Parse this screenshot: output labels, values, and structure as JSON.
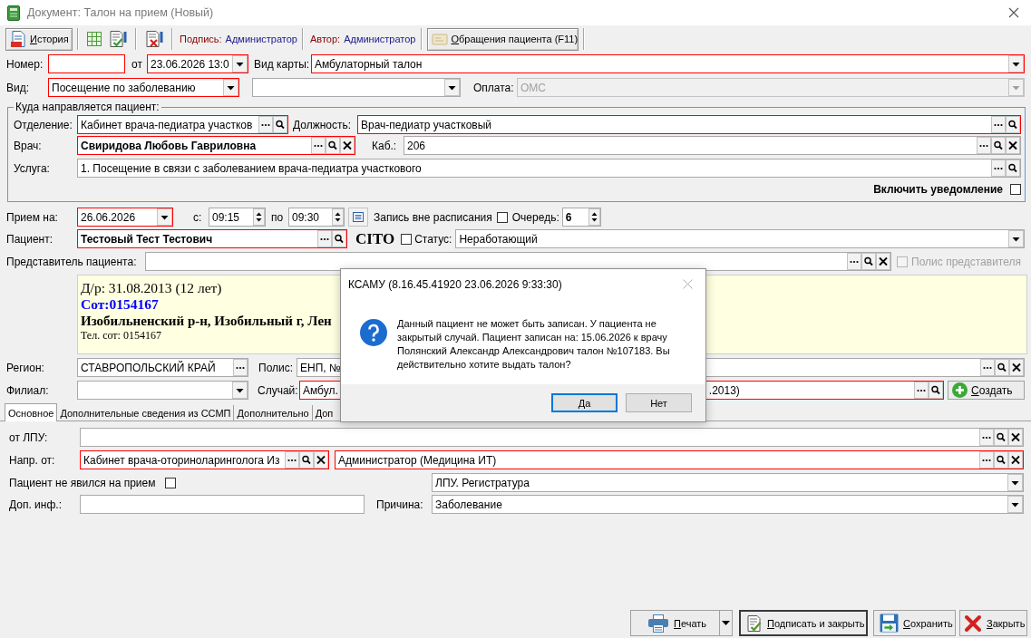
{
  "window": {
    "title": "Документ: Талон на прием (Новый)"
  },
  "toolbar": {
    "history_button": "История",
    "signature": {
      "label": "Подпись:",
      "value": "Администратор"
    },
    "author": {
      "label": "Автор:",
      "value": "Администратор"
    },
    "appeals_button": "Обращения пациента (F11)"
  },
  "header": {
    "number": {
      "label": "Номер:",
      "kind": "text",
      "required": true
    },
    "date": {
      "label": "от",
      "kind": "combo",
      "value": "23.06.2026 13:0",
      "required": true
    },
    "card_type": {
      "label": "Вид карты:",
      "kind": "combo",
      "value": "Амбулаторный талон",
      "required": true
    },
    "visit_type": {
      "label": "Вид:",
      "kind": "combo",
      "value": "Посещение по заболеванию",
      "required": true
    },
    "combo_2": {
      "kind": "combo",
      "required": false
    },
    "payment": {
      "label": "Оплата:",
      "kind": "combo",
      "value": "ОМС",
      "required": false,
      "disabled": true
    }
  },
  "destination": {
    "title": "Куда направляется пациент:",
    "department": {
      "label": "Отделение:",
      "kind": "lookup",
      "value": "Кабинет врача-педиатра участков",
      "required": true,
      "searchable": true,
      "clearable": false
    },
    "position": {
      "label": "Должность:",
      "kind": "lookup",
      "value": "Врач-педиатр участковый",
      "required": true,
      "searchable": true,
      "clearable": false
    },
    "doctor": {
      "label": "Врач:",
      "kind": "lookup",
      "value": "Свиридова Любовь Гавриловна",
      "required": true,
      "searchable": true,
      "clearable": true
    },
    "room": {
      "label": "Каб.:",
      "kind": "lookup",
      "value": "206",
      "required": false,
      "searchable": true,
      "clearable": true
    },
    "service": {
      "label": "Услуга:",
      "kind": "lookup",
      "value": "1. Посещение в связи с заболеванием врача-педиатра участкового",
      "required": false,
      "searchable": true,
      "clearable": false
    },
    "notify": {
      "label": "Включить уведомление",
      "checked": false
    }
  },
  "appointment": {
    "date": {
      "label": "Прием на:",
      "kind": "combo",
      "value": "26.06.2026",
      "required": true
    },
    "time_from": {
      "label": "с:",
      "kind": "spin",
      "value": "09:15",
      "required": false
    },
    "time_to": {
      "label": "по",
      "kind": "spin",
      "value": "09:30",
      "required": false
    },
    "unscheduled": {
      "label": "Запись вне расписания",
      "checked": false
    },
    "queue": {
      "label": "Очередь:",
      "kind": "spin",
      "value": "6",
      "required": false
    }
  },
  "patient": {
    "name": {
      "label": "Пациент:",
      "kind": "lookup",
      "value": "Тестовый Тест Тестович",
      "required": true,
      "searchable": true,
      "clearable": false
    },
    "cito": {
      "label": "CITO",
      "checked": false
    },
    "status": {
      "label": "Статус:",
      "kind": "combo",
      "value": "Неработающий",
      "required": false
    },
    "representative": {
      "label": "Представитель пациента:",
      "kind": "lookup",
      "required": false,
      "searchable": true,
      "clearable": true
    },
    "representative_policy": {
      "label": "Полис представителя",
      "checked": false,
      "disabled": true
    }
  },
  "patient_info": [
    {
      "kind": "normal",
      "text": "Д/р: 31.08.2013 (12 лет)"
    },
    {
      "kind": "accent",
      "text": "Сот:0154167"
    },
    {
      "kind": "bold",
      "text": "Изобильненский р-н, Изобильный г, Лен"
    },
    {
      "kind": "small",
      "text": "Тел. сот: 0154167"
    }
  ],
  "insurance": {
    "region": {
      "label": "Регион:",
      "kind": "lookup",
      "value": "СТАВРОПОЛЬСКИЙ КРАЙ",
      "required": false,
      "searchable": false,
      "clearable": false
    },
    "policy": {
      "label": "Полис:",
      "kind": "lookup",
      "value": "ЕНП, №",
      "required": false,
      "searchable": true,
      "clearable": true
    },
    "branch": {
      "label": "Филиал:",
      "kind": "combo",
      "required": false
    },
    "case": {
      "label": "Случай:",
      "kind": "lookup",
      "value": "Амбул.",
      "value_end": ".2013)",
      "required": true,
      "searchable": true,
      "clearable": false
    },
    "create_button": "Создать"
  },
  "tabs": [
    {
      "label": "Основное",
      "selected": true
    },
    {
      "label": "Дополнительные сведения из ССМП",
      "selected": false
    },
    {
      "label": "Дополнительно",
      "selected": false
    },
    {
      "label": "Доп",
      "selected": false
    }
  ],
  "main_tab": {
    "from_lpu": {
      "label": "от ЛПУ:",
      "kind": "lookup",
      "required": false,
      "searchable": true,
      "clearable": true
    },
    "referred_by": {
      "label": "Напр. от:",
      "department": {
        "kind": "lookup",
        "value": "Кабинет врача-оториноларинголога Из",
        "required": true,
        "searchable": true,
        "clearable": true
      },
      "person": {
        "kind": "lookup",
        "value": "Администратор (Медицина ИТ)",
        "required": true,
        "searchable": true,
        "clearable": true
      }
    },
    "no_show": {
      "label": "Пациент не явился на прием",
      "checked": false
    },
    "registry": {
      "kind": "combo",
      "value": "ЛПУ. Регистратура",
      "required": false
    },
    "extra_info": {
      "label": "Доп. инф.:",
      "kind": "text",
      "required": false
    },
    "reason": {
      "label": "Причина:",
      "kind": "combo",
      "value": "Заболевание",
      "required": false
    }
  },
  "footer": {
    "buttons": [
      {
        "kind": "print",
        "label": "Печать",
        "default": false
      },
      {
        "kind": "sign",
        "label": "Подписать и закрыть",
        "default": true
      },
      {
        "kind": "save",
        "label": "Сохранить",
        "default": false
      },
      {
        "kind": "close",
        "label": "Закрыть",
        "default": false
      }
    ]
  },
  "dialog": {
    "title": "КСАМУ (8.16.45.41920 23.06.2026 9:33:30)",
    "message": "Данный пациент не может быть записан. У пациента не закрытый случай. Пациент записан на: 15.06.2026 к врачу Полянский Александр Александрович талон №107183. Вы действительно хотите выдать талон?",
    "buttons": [
      {
        "label": "Да",
        "default": true
      },
      {
        "label": "Нет",
        "default": false
      }
    ]
  }
}
